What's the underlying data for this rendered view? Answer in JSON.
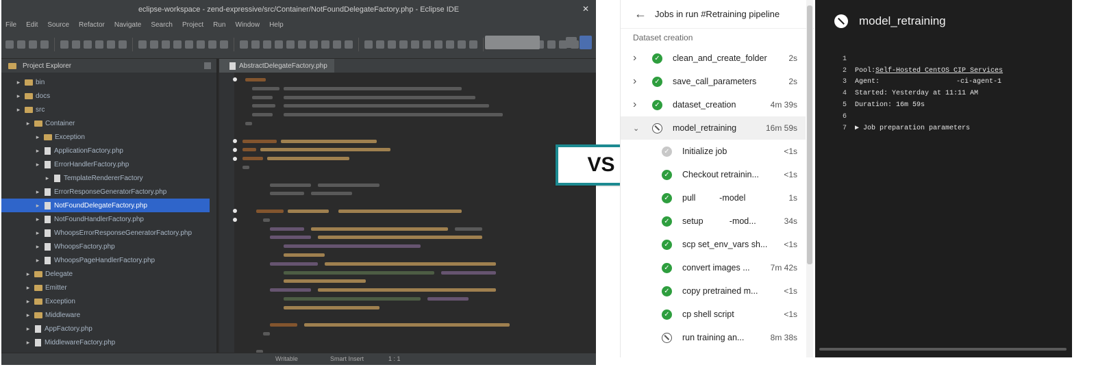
{
  "ide": {
    "window_title": "eclipse-workspace - zend-expressive/src/Container/NotFoundDelegateFactory.php - Eclipse IDE",
    "menu": [
      "File",
      "Edit",
      "Source",
      "Refactor",
      "Navigate",
      "Search",
      "Project",
      "Run",
      "Window",
      "Help"
    ],
    "explorer_tab": "Project Explorer",
    "editor_tab": "AbstractDelegateFactory.php",
    "tree": [
      {
        "label": "bin",
        "type": "folder",
        "indent": 1
      },
      {
        "label": "docs",
        "type": "folder",
        "indent": 1
      },
      {
        "label": "src",
        "type": "folder",
        "indent": 1
      },
      {
        "label": "Container",
        "type": "folder",
        "indent": 2
      },
      {
        "label": "Exception",
        "type": "folder",
        "indent": 3
      },
      {
        "label": "ApplicationFactory.php",
        "type": "file",
        "indent": 3
      },
      {
        "label": "ErrorHandlerFactory.php",
        "type": "file",
        "indent": 3
      },
      {
        "label": "TemplateRendererFactory",
        "type": "file",
        "indent": 4
      },
      {
        "label": "ErrorResponseGeneratorFactory.php",
        "type": "file",
        "indent": 3
      },
      {
        "label": "NotFoundDelegateFactory.php",
        "type": "file",
        "indent": 3,
        "selected": true
      },
      {
        "label": "NotFoundHandlerFactory.php",
        "type": "file",
        "indent": 3
      },
      {
        "label": "WhoopsErrorResponseGeneratorFactory.php",
        "type": "file",
        "indent": 3
      },
      {
        "label": "WhoopsFactory.php",
        "type": "file",
        "indent": 3
      },
      {
        "label": "WhoopsPageHandlerFactory.php",
        "type": "file",
        "indent": 3
      },
      {
        "label": "Delegate",
        "type": "folder",
        "indent": 2
      },
      {
        "label": "Emitter",
        "type": "folder",
        "indent": 2
      },
      {
        "label": "Exception",
        "type": "folder",
        "indent": 2
      },
      {
        "label": "Middleware",
        "type": "folder",
        "indent": 2
      },
      {
        "label": "AppFactory.php",
        "type": "file",
        "indent": 2
      },
      {
        "label": "MiddlewareFactory.php",
        "type": "file",
        "indent": 2
      }
    ],
    "status_items": [
      "Writable",
      "Smart Insert",
      "1 : 1"
    ]
  },
  "vs_label": "VS",
  "jobs_panel": {
    "title": "Jobs in run #Retraining pipeline",
    "stage": "Dataset creation",
    "jobs": [
      {
        "name": "clean_and_create_folder",
        "duration": "2s",
        "status": "success",
        "level": 0,
        "chevron": "right"
      },
      {
        "name": "save_call_parameters",
        "duration": "2s",
        "status": "success",
        "level": 0,
        "chevron": "right"
      },
      {
        "name": "dataset_creation",
        "duration": "4m 39s",
        "status": "success",
        "level": 0,
        "chevron": "right"
      },
      {
        "name": "model_retraining",
        "duration": "16m 59s",
        "status": "cancelled",
        "level": 0,
        "chevron": "down"
      },
      {
        "name": "Initialize job",
        "duration": "<1s",
        "status": "pending",
        "level": 1
      },
      {
        "name": "Checkout retrainin...",
        "duration": "<1s",
        "status": "success",
        "level": 1
      },
      {
        "name": "pull          -model",
        "duration": "1s",
        "status": "success",
        "level": 1
      },
      {
        "name": "setup           -mod...",
        "duration": "34s",
        "status": "success",
        "level": 1
      },
      {
        "name": "scp set_env_vars sh...",
        "duration": "<1s",
        "status": "success",
        "level": 1
      },
      {
        "name": "convert images ...",
        "duration": "7m 42s",
        "status": "success",
        "level": 1
      },
      {
        "name": "copy pretrained m...",
        "duration": "<1s",
        "status": "success",
        "level": 1
      },
      {
        "name": "cp shell script",
        "duration": "<1s",
        "status": "success",
        "level": 1
      },
      {
        "name": "run training an...",
        "duration": "8m 38s",
        "status": "cancelled",
        "level": 1
      }
    ]
  },
  "log_panel": {
    "title": "model_retraining",
    "lines": [
      {
        "num": "1",
        "text": ""
      },
      {
        "num": "2",
        "label": "Pool: ",
        "link": "Self-Hosted CentOS CIP Services"
      },
      {
        "num": "3",
        "label": "Agent:",
        "value": "-ci-agent-1"
      },
      {
        "num": "4",
        "text": "Started: Yesterday at 11:11 AM"
      },
      {
        "num": "5",
        "text": "Duration: 16m 59s"
      },
      {
        "num": "6",
        "text": ""
      },
      {
        "num": "7",
        "text": "▶ Job preparation parameters"
      }
    ]
  }
}
